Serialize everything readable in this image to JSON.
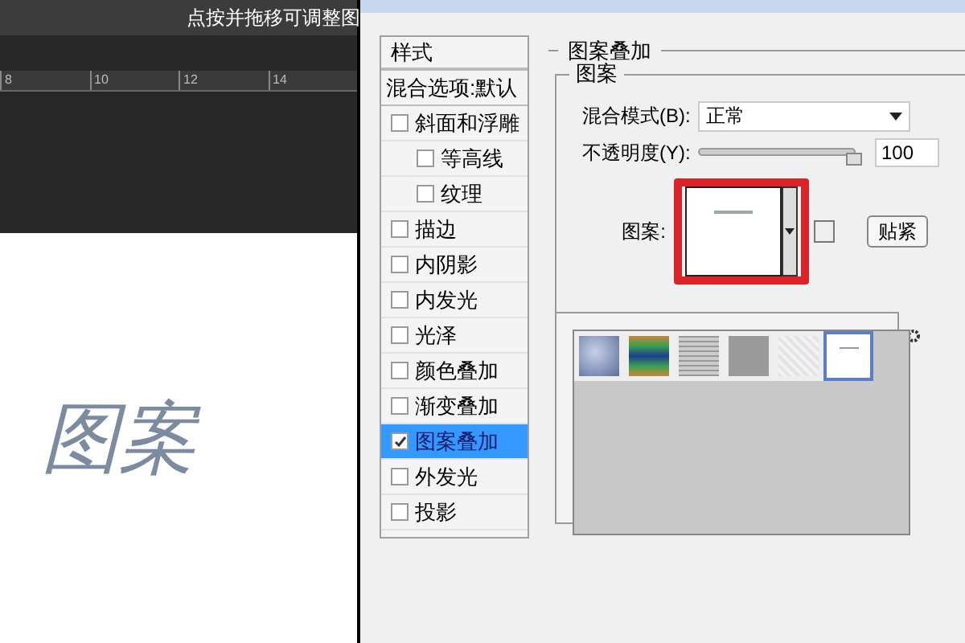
{
  "tooltip": "点按并拖移可调整图",
  "ruler": {
    "ticks": [
      "8",
      "10",
      "12",
      "14"
    ]
  },
  "canvas": {
    "text": "图案"
  },
  "dialog": {
    "styles_header": "样式",
    "blend_options": "混合选项:默认",
    "effects": [
      {
        "label": "斜面和浮雕",
        "checked": false,
        "selected": false,
        "children": [
          {
            "label": "等高线",
            "checked": false,
            "selected": false
          },
          {
            "label": "纹理",
            "checked": false,
            "selected": false
          }
        ]
      },
      {
        "label": "描边",
        "checked": false,
        "selected": false
      },
      {
        "label": "内阴影",
        "checked": false,
        "selected": false
      },
      {
        "label": "内发光",
        "checked": false,
        "selected": false
      },
      {
        "label": "光泽",
        "checked": false,
        "selected": false
      },
      {
        "label": "颜色叠加",
        "checked": false,
        "selected": false
      },
      {
        "label": "渐变叠加",
        "checked": false,
        "selected": false
      },
      {
        "label": "图案叠加",
        "checked": true,
        "selected": true
      },
      {
        "label": "外发光",
        "checked": false,
        "selected": false
      },
      {
        "label": "投影",
        "checked": false,
        "selected": false
      }
    ],
    "section_title": "图案叠加",
    "group_title": "图案",
    "blend_mode": {
      "label": "混合模式(B):",
      "value": "正常"
    },
    "opacity": {
      "label": "不透明度(Y):",
      "level": 1.0,
      "value": "100"
    },
    "pattern": {
      "label": "图案:",
      "highlighted": true,
      "snap_button": "贴紧"
    },
    "patterns": [
      {
        "kind": "bubbles",
        "selected": false
      },
      {
        "kind": "rainbow",
        "selected": false
      },
      {
        "kind": "lines",
        "selected": false
      },
      {
        "kind": "gray",
        "selected": false
      },
      {
        "kind": "paper",
        "selected": false
      },
      {
        "kind": "text",
        "selected": true
      }
    ]
  }
}
